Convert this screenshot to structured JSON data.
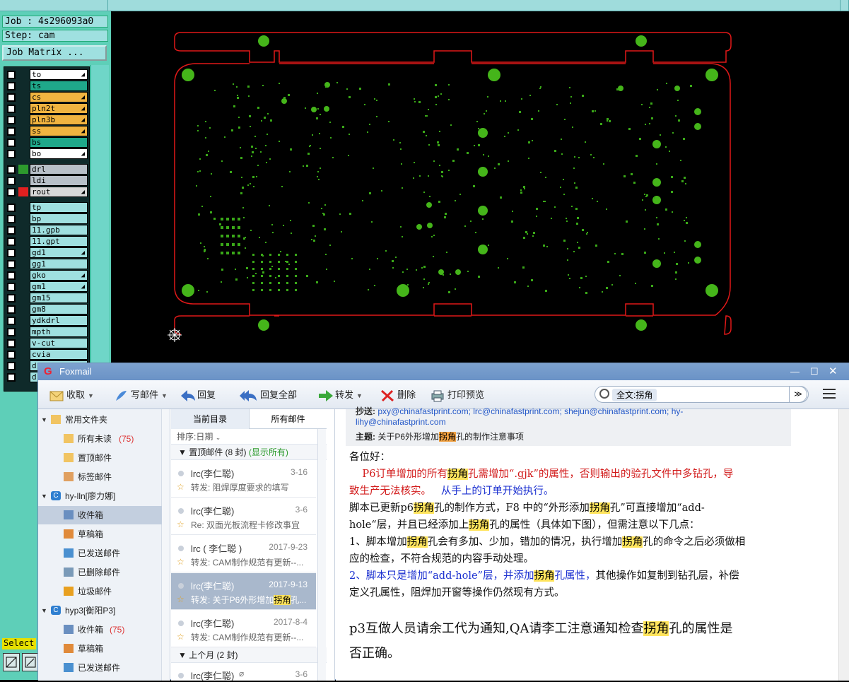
{
  "cam": {
    "job": "Job : 4s296093a0",
    "step": "Step: cam",
    "job_matrix_button": "Job Matrix ...",
    "select_label": "Select",
    "layers_group1": [
      {
        "name": "to",
        "color": "#ffffff",
        "arrow": true
      },
      {
        "name": "ts",
        "color": "#1fa88a",
        "arrow": false
      },
      {
        "name": "cs",
        "color": "#f0b440",
        "arrow": true
      },
      {
        "name": "pln2t",
        "color": "#f0b440",
        "arrow": true
      },
      {
        "name": "pln3b",
        "color": "#f0b440",
        "arrow": true
      },
      {
        "name": "ss",
        "color": "#f0b440",
        "arrow": true
      },
      {
        "name": "bs",
        "color": "#1fa88a",
        "arrow": false
      },
      {
        "name": "bo",
        "color": "#ffffff",
        "arrow": true
      }
    ],
    "layers_group2": [
      {
        "name": "drl",
        "color": "#b8c0c8",
        "swatch": "#2d9a2d",
        "arrow": false
      },
      {
        "name": "ldi",
        "color": "#b8c0c8",
        "swatch": "",
        "arrow": false
      },
      {
        "name": "rout",
        "color": "#d8d8d8",
        "swatch": "#e02020",
        "arrow": true
      }
    ],
    "layers_group3": [
      {
        "name": "tp",
        "arrow": false
      },
      {
        "name": "bp",
        "arrow": false
      },
      {
        "name": "11.gpb",
        "arrow": false
      },
      {
        "name": "11.gpt",
        "arrow": false
      },
      {
        "name": "gd1",
        "arrow": true
      },
      {
        "name": "gg1",
        "arrow": false
      },
      {
        "name": "gko",
        "arrow": true
      },
      {
        "name": "gm1",
        "arrow": true
      },
      {
        "name": "gm15",
        "arrow": false
      },
      {
        "name": "gm8",
        "arrow": false
      },
      {
        "name": "ydkdrl",
        "arrow": false
      },
      {
        "name": "mpth",
        "arrow": false
      },
      {
        "name": "v-cut",
        "arrow": false
      },
      {
        "name": "cvia",
        "arrow": false
      },
      {
        "name": "drl",
        "arrow": false
      },
      {
        "name": "d",
        "arrow": false
      }
    ]
  },
  "foxmail": {
    "title": "Foxmail",
    "toolbar": {
      "receive": "收取",
      "compose": "写邮件",
      "reply": "回复",
      "reply_all": "回复全部",
      "forward": "转发",
      "delete": "删除",
      "print": "打印预览",
      "search_tag": "全文:拐角"
    },
    "folders": [
      {
        "label": "常用文件夹",
        "icon": "folder-icon",
        "indent": 0,
        "count": ""
      },
      {
        "label": "所有未读",
        "icon": "folder-icon",
        "indent": 1,
        "count": "(75)"
      },
      {
        "label": "置顶邮件",
        "icon": "star-icon",
        "indent": 1,
        "count": ""
      },
      {
        "label": "标签邮件",
        "icon": "tag-icon",
        "indent": 1,
        "count": ""
      },
      {
        "label": "hy-lln[廖力娜]",
        "icon": "account-icon",
        "indent": 0,
        "count": ""
      },
      {
        "label": "收件箱",
        "icon": "inbox-icon",
        "indent": 1,
        "count": "",
        "selected": true
      },
      {
        "label": "草稿箱",
        "icon": "draft-icon",
        "indent": 1,
        "count": ""
      },
      {
        "label": "已发送邮件",
        "icon": "sent-icon",
        "indent": 1,
        "count": ""
      },
      {
        "label": "已删除邮件",
        "icon": "trash-icon",
        "indent": 1,
        "count": ""
      },
      {
        "label": "垃圾邮件",
        "icon": "junk-icon",
        "indent": 1,
        "count": ""
      },
      {
        "label": "hyp3[衡阳P3]",
        "icon": "account-icon",
        "indent": 0,
        "count": ""
      },
      {
        "label": "收件箱",
        "icon": "inbox-icon",
        "indent": 1,
        "count": "(75)"
      },
      {
        "label": "草稿箱",
        "icon": "draft-icon",
        "indent": 1,
        "count": ""
      },
      {
        "label": "已发送邮件",
        "icon": "sent-icon",
        "indent": 1,
        "count": ""
      }
    ],
    "list": {
      "tab_current": "当前目录",
      "tab_all": "所有邮件",
      "sort": "排序:日期",
      "group_pinned": "置顶邮件 (8 封)",
      "group_pinned_show": "(显示所有)",
      "group_lastmonth": "上个月 (2 封)",
      "mails": [
        {
          "from": "lrc(李仁聪)",
          "date": "3-16",
          "subject": "转发: 阻焊厚度要求的填写",
          "selected": false
        },
        {
          "from": "lrc(李仁聪)",
          "date": "3-6",
          "subject": "Re: 双面光板流程卡修改事宜",
          "selected": false
        },
        {
          "from": "lrc ( 李仁聪 )",
          "date": "2017-9-23",
          "subject": "转发: CAM制作规范有更新--...",
          "selected": false
        },
        {
          "from": "lrc(李仁聪)",
          "date": "2017-9-13",
          "subject_pre": "转发: 关于P6外形增加",
          "subject_hl": "拐角",
          "subject_post": "孔...",
          "selected": true
        },
        {
          "from": "lrc(李仁聪)",
          "date": "2017-8-4",
          "subject": "转发: CAM制作规范有更新--...",
          "selected": false
        }
      ],
      "last_mail": {
        "from": "lrc(李仁聪)",
        "date": "3-6"
      }
    },
    "reader": {
      "cc_label": "抄送:",
      "cc_line1": "pxy@chinafastprint.com; lrc@chinafastprint.com; shejun@chinafastprint.com; hy-",
      "cc_line2": "lihy@chinafastprint.com",
      "subject_label": "主题:",
      "subject_pre": "关于P6外形增加",
      "subject_hl": "拐角",
      "subject_post": "孔的制作注意事项",
      "greeting": "各位好：",
      "p1a": "    P6订单增加的所有",
      "p1b": "孔需增加“.gjk”的属性，否则输出的验孔文件中多钻孔，导",
      "p2a": "致生产无法核实。   ",
      "p2b": "从手上的订单开始执行。",
      "p3a": "脚本已更新p6",
      "p3b": "孔的制作方式，F8 中的“外形添加",
      "p3c": "孔”可直接增加“add-",
      "p4a": "hole“层，并且已经添加上",
      "p4b": "孔的属性（具体如下图），但需注意以下几点：",
      "p5a": "1、脚本增加",
      "p5b": "孔会有多加、少加，错加的情况，执行增加",
      "p5c": "孔的命令之后必须做相",
      "p6": "应的检查，不符合规范的内容手动处理。",
      "p7a": "2、脚本只是增加“add-hole”层，并添加",
      "p7b": "孔属性，",
      "p7c": "其他操作如复制到钻孔层，补偿",
      "p8": "定义孔属性，阻焊加开窗等操作仍然现有方式。",
      "p9a": "p3互做人员请余工代为通知,QA请李工注意通知检查",
      "p9b": "孔的属性是",
      "p10": "否正确。",
      "hl_word": "拐角"
    }
  }
}
